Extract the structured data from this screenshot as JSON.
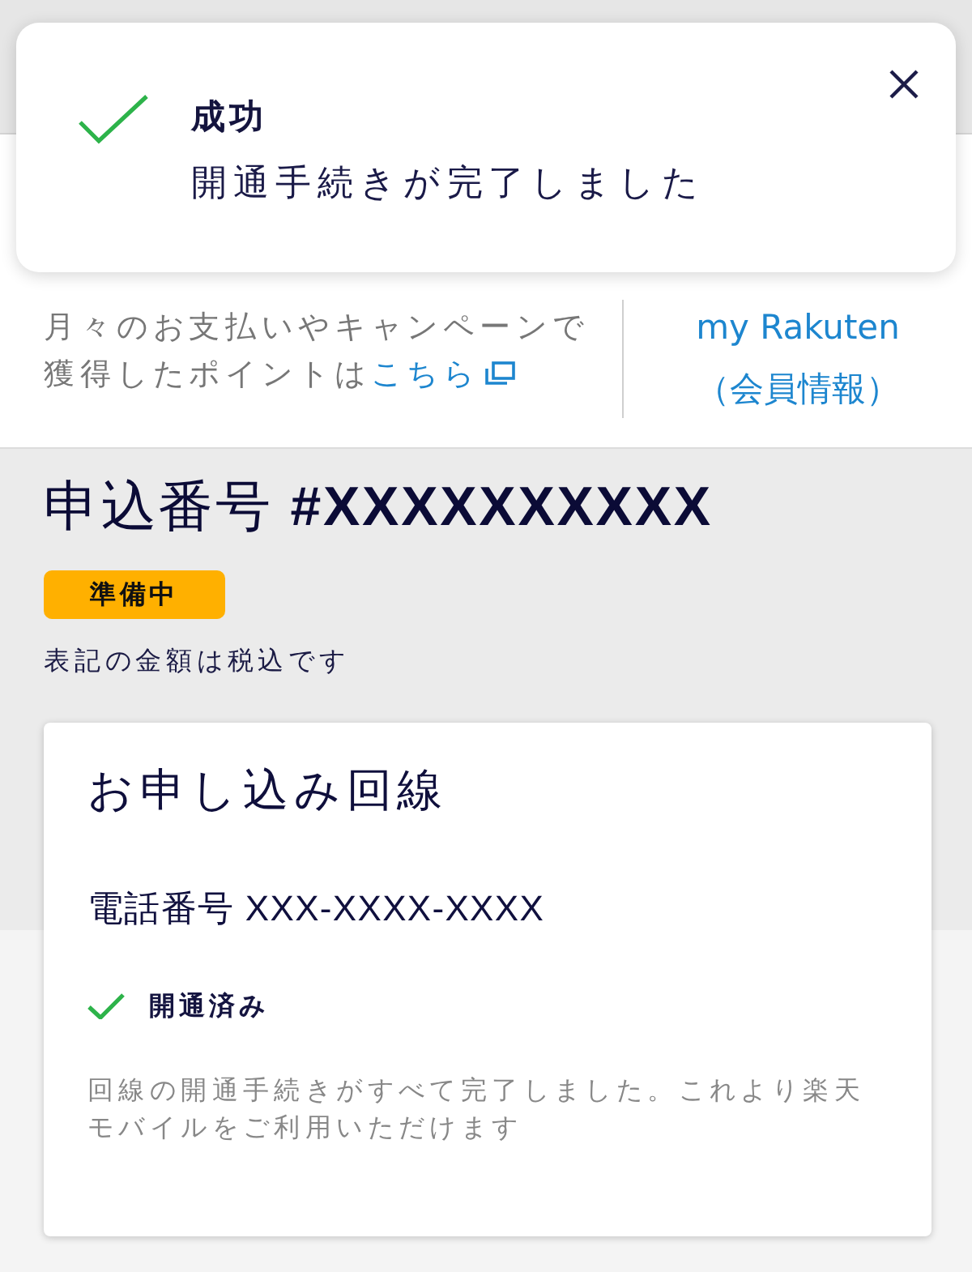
{
  "toast": {
    "title": "成功",
    "message": "開通手続きが完了しました"
  },
  "points_note": {
    "text": "月々のお支払いやキャンペーンで獲得したポイントは",
    "link": "こちら"
  },
  "member_link": {
    "label": "my Rakuten（会員情報）"
  },
  "order": {
    "title": "申込番号 **#XXXXXXXXXX**",
    "status_badge": "準備中",
    "tax_note": "表記の金額は税込です"
  },
  "line_card": {
    "title": "お申し込み回線",
    "phone": "電話番号 XXX-XXXX-XXXX",
    "status": {
      "label": "開通済み",
      "done": true
    },
    "description": "回線の開通手続きがすべて完了しました。これより楽天モバイルをご利用いただけます"
  }
}
